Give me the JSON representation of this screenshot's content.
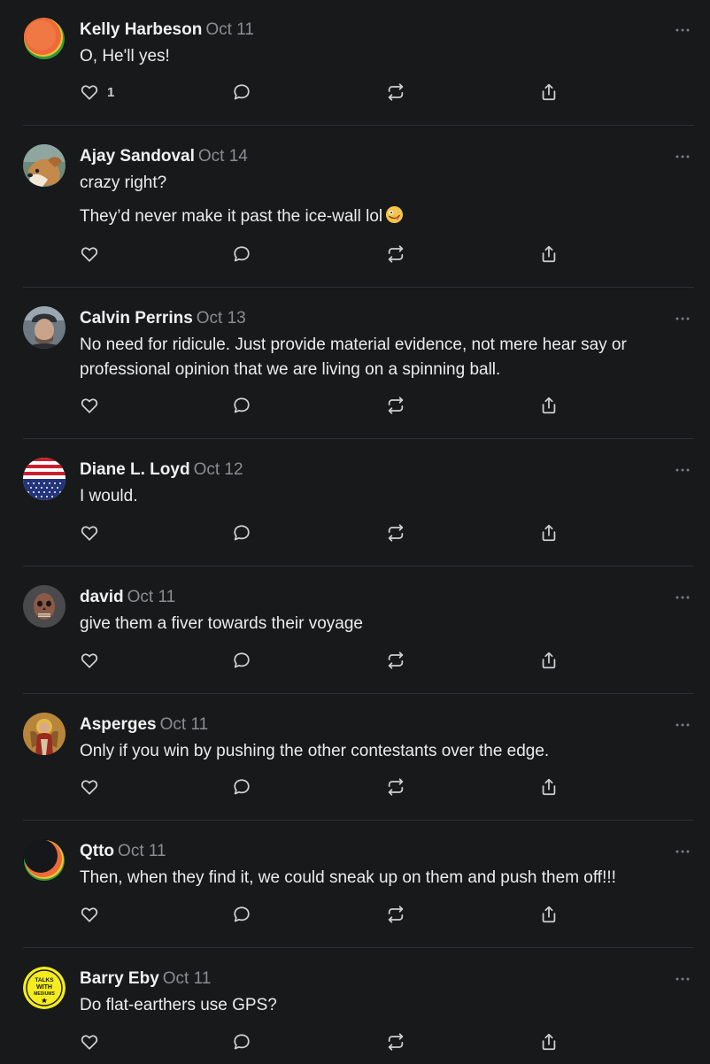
{
  "comments": [
    {
      "author": "Kelly Harbeson",
      "date": "Oct 11",
      "paragraphs": [
        "O, He'll yes!"
      ],
      "like_count": "1",
      "avatar": "orange-green-circle-avatar"
    },
    {
      "author": "Ajay Sandoval",
      "date": "Oct 14",
      "paragraphs": [
        "crazy right?",
        "They’d never make it past the ice-wall lol"
      ],
      "emoji": "zany-face",
      "avatar": "dog-photo-avatar"
    },
    {
      "author": "Calvin Perrins",
      "date": "Oct 13",
      "paragraphs": [
        "No need for ridicule. Just provide material evidence, not mere hear say or professional opinion that we are living on a spinning ball."
      ],
      "avatar": "man-with-cap-photo-avatar"
    },
    {
      "author": "Diane L. Loyd",
      "date": "Oct 12",
      "paragraphs": [
        "I would."
      ],
      "avatar": "us-flag-avatar"
    },
    {
      "author": "david",
      "date": "Oct 11",
      "paragraphs": [
        "give them a fiver towards their voyage"
      ],
      "avatar": "skull-photo-avatar"
    },
    {
      "author": "Asperges",
      "date": "Oct 11",
      "paragraphs": [
        "Only if you win by pushing the other contestants over the edge."
      ],
      "avatar": "angel-icon-painting-avatar"
    },
    {
      "author": "Qtto",
      "date": "Oct 11",
      "paragraphs": [
        "Then, when they find it, we could sneak up on them and push them off!!!"
      ],
      "avatar": "eclipse-circle-avatar"
    },
    {
      "author": "Barry Eby",
      "date": "Oct 11",
      "paragraphs": [
        "Do flat-earthers use GPS?"
      ],
      "avatar": "talks-with-mediums-logo-avatar",
      "avatar_text": [
        "TALKS",
        "WITH",
        "MEDIUMS"
      ]
    }
  ],
  "icons": {
    "like": "heart-icon",
    "reply": "speech-bubble-icon",
    "restack": "restack-arrows-icon",
    "share": "share-upload-icon",
    "more": "ellipsis-icon"
  },
  "colors": {
    "background": "#18191b",
    "text": "#ededed",
    "muted": "#8c8d90",
    "divider": "#2e2f32"
  }
}
